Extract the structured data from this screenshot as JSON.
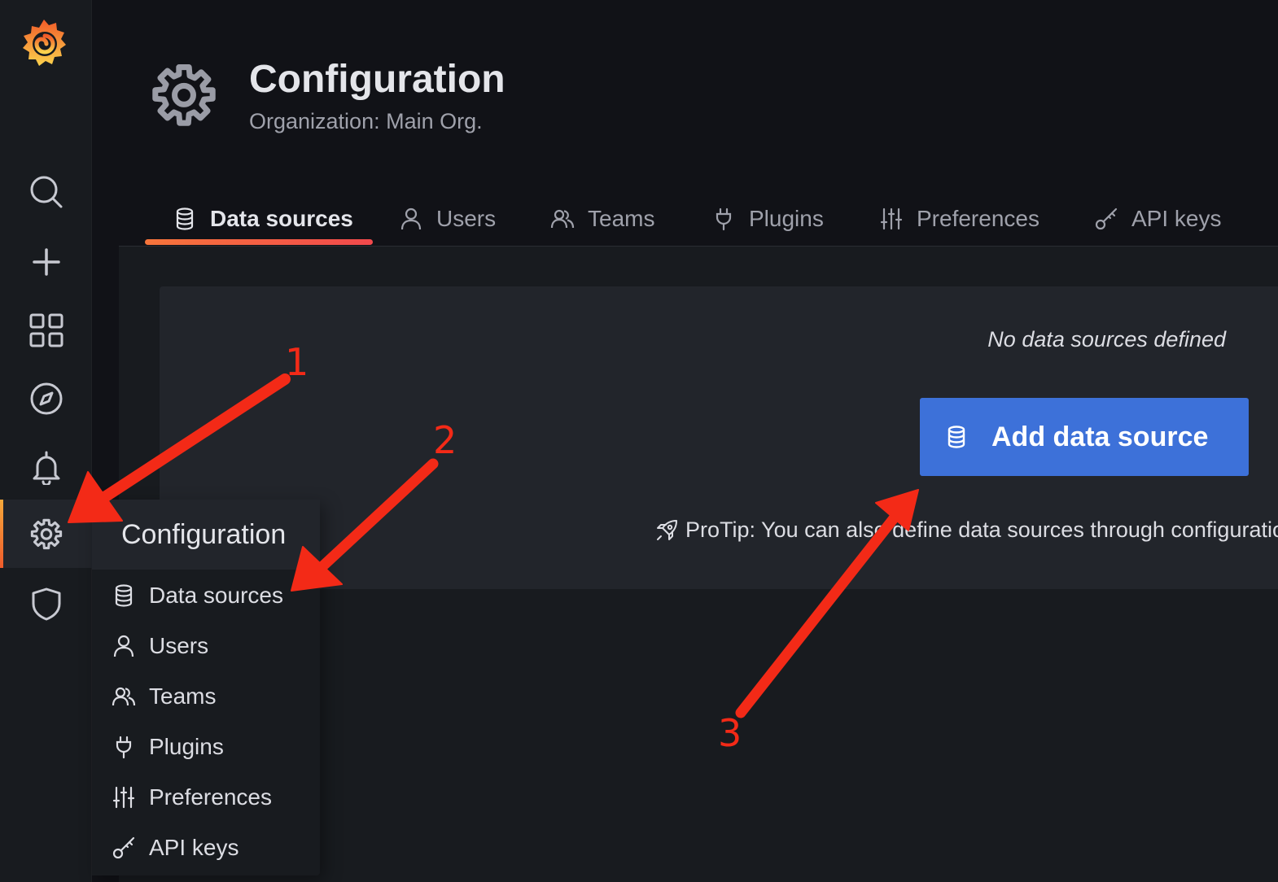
{
  "app": {
    "logo_icon": "grafana-logo",
    "accent_color": "#f46800"
  },
  "sidebar": {
    "items": [
      {
        "name": "search",
        "icon": "search-icon"
      },
      {
        "name": "create",
        "icon": "plus-icon"
      },
      {
        "name": "dashboards",
        "icon": "apps-grid-icon"
      },
      {
        "name": "explore",
        "icon": "compass-icon"
      },
      {
        "name": "alerting",
        "icon": "bell-icon"
      },
      {
        "name": "configuration",
        "icon": "gear-icon",
        "active": true
      },
      {
        "name": "server-admin",
        "icon": "shield-icon"
      }
    ]
  },
  "flyout": {
    "title": "Configuration",
    "items": [
      {
        "label": "Data sources",
        "icon": "database-icon"
      },
      {
        "label": "Users",
        "icon": "user-icon"
      },
      {
        "label": "Teams",
        "icon": "users-icon"
      },
      {
        "label": "Plugins",
        "icon": "plug-icon"
      },
      {
        "label": "Preferences",
        "icon": "sliders-icon"
      },
      {
        "label": "API keys",
        "icon": "key-icon"
      }
    ]
  },
  "header": {
    "icon": "gear-icon",
    "title": "Configuration",
    "subtitle": "Organization: Main Org."
  },
  "tabs": [
    {
      "label": "Data sources",
      "icon": "database-icon",
      "active": true
    },
    {
      "label": "Users",
      "icon": "user-icon"
    },
    {
      "label": "Teams",
      "icon": "users-icon"
    },
    {
      "label": "Plugins",
      "icon": "plug-icon"
    },
    {
      "label": "Preferences",
      "icon": "sliders-icon"
    },
    {
      "label": "API keys",
      "icon": "key-icon"
    }
  ],
  "empty_state": {
    "title": "No data sources defined",
    "button_label": "Add data source",
    "button_icon": "database-icon",
    "button_color": "#3d71d9",
    "protip_icon": "rocket-icon",
    "protip_text": "ProTip: You can also define data sources through configuration files"
  },
  "annotations": {
    "color": "#f32a17",
    "labels": [
      "1",
      "2",
      "3"
    ]
  }
}
